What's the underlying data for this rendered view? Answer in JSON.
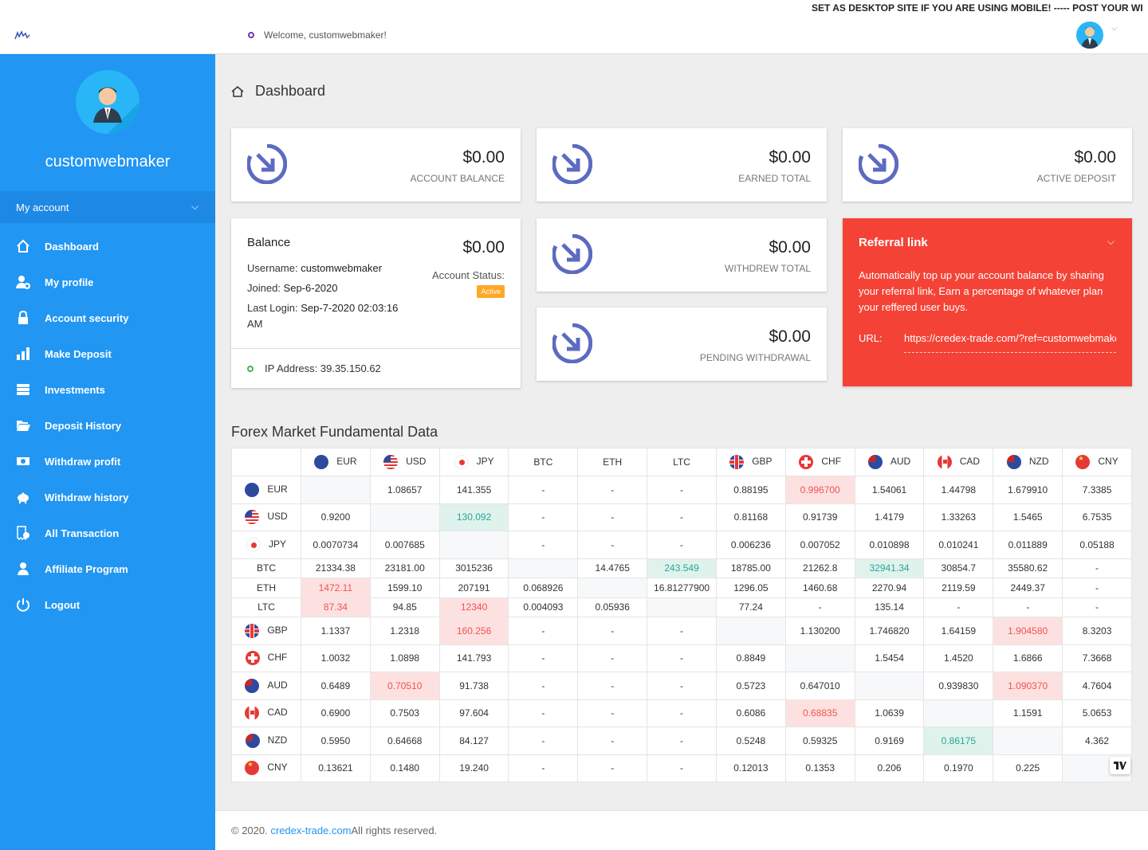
{
  "marquee": "SET AS DESKTOP SITE IF YOU ARE USING MOBILE! ----- POST YOUR WI",
  "topbar": {
    "welcome": "Welcome, customwebmaker!"
  },
  "sidebar": {
    "username": "customwebmaker",
    "account_label": "My account",
    "items": [
      {
        "label": "Dashboard",
        "icon": "home-icon"
      },
      {
        "label": "My profile",
        "icon": "user-add-icon"
      },
      {
        "label": "Account security",
        "icon": "lock-icon"
      },
      {
        "label": "Make Deposit",
        "icon": "bar-chart-icon"
      },
      {
        "label": "Investments",
        "icon": "stack-icon"
      },
      {
        "label": "Deposit History",
        "icon": "folder-open-icon"
      },
      {
        "label": "Withdraw profit",
        "icon": "money-icon"
      },
      {
        "label": "Withdraw history",
        "icon": "piggy-bank-icon"
      },
      {
        "label": "All Transaction",
        "icon": "receipt-icon"
      },
      {
        "label": "Affiliate Program",
        "icon": "users-icon"
      },
      {
        "label": "Logout",
        "icon": "power-icon"
      }
    ]
  },
  "page_title": "Dashboard",
  "stats": {
    "account_balance": {
      "amount": "$0.00",
      "label": "ACCOUNT BALANCE"
    },
    "earned_total": {
      "amount": "$0.00",
      "label": "EARNED TOTAL"
    },
    "active_deposit": {
      "amount": "$0.00",
      "label": "ACTIVE DEPOSIT"
    },
    "withdrew_total": {
      "amount": "$0.00",
      "label": "WITHDREW TOTAL"
    },
    "pending_withdrawal": {
      "amount": "$0.00",
      "label": "PENDING WITHDRAWAL"
    }
  },
  "balance": {
    "title": "Balance",
    "amount": "$0.00",
    "username_label": "Username:",
    "username": "customwebmaker",
    "joined_label": "Joined:",
    "joined": "Sep-6-2020",
    "last_login_label": "Last Login:",
    "last_login": "Sep-7-2020 02:03:16",
    "last_login_suffix": "AM",
    "status_label": "Account Status:",
    "status": "Active",
    "ip_label": "IP Address:",
    "ip": "39.35.150.62"
  },
  "referral": {
    "title": "Referral link",
    "description": "Automatically top up your account balance by sharing your referral link, Earn a percentage of whatever plan your reffered user buys.",
    "url_label": "URL:",
    "url": "https://credex-trade.com/?ref=customwebmaker"
  },
  "forex": {
    "title": "Forex Market Fundamental Data",
    "columns": [
      "EUR",
      "USD",
      "JPY",
      "BTC",
      "ETH",
      "LTC",
      "GBP",
      "CHF",
      "AUD",
      "CAD",
      "NZD",
      "CNY"
    ],
    "flagged": {
      "EUR": "eur",
      "USD": "usd",
      "JPY": "jpy",
      "GBP": "gbp",
      "CHF": "chf",
      "AUD": "aud",
      "CAD": "cad",
      "NZD": "nzd",
      "CNY": "cny"
    },
    "rows": [
      {
        "label": "EUR",
        "cells": [
          "",
          "1.08657",
          "141.355",
          "-",
          "-",
          "-",
          "0.88195",
          "0.996700",
          "1.54061",
          "1.44798",
          "1.679910",
          "7.3385"
        ],
        "styles": [
          "e",
          "",
          "",
          "",
          "",
          "",
          "",
          "lo",
          "",
          "",
          "",
          ""
        ]
      },
      {
        "label": "USD",
        "cells": [
          "0.9200",
          "",
          "130.092",
          "-",
          "-",
          "-",
          "0.81168",
          "0.91739",
          "1.4179",
          "1.33263",
          "1.5465",
          "6.7535"
        ],
        "styles": [
          "",
          "e",
          "hi",
          "",
          "",
          "",
          "",
          "",
          "",
          "",
          "",
          ""
        ]
      },
      {
        "label": "JPY",
        "cells": [
          "0.0070734",
          "0.007685",
          "",
          "-",
          "-",
          "-",
          "0.006236",
          "0.007052",
          "0.010898",
          "0.010241",
          "0.011889",
          "0.05188"
        ],
        "styles": [
          "",
          "",
          "e",
          "",
          "",
          "",
          "",
          "",
          "",
          "",
          "",
          ""
        ]
      },
      {
        "label": "BTC",
        "cells": [
          "21334.38",
          "23181.00",
          "3015236",
          "",
          "14.4765",
          "243.549",
          "18785.00",
          "21262.8",
          "32941.34",
          "30854.7",
          "35580.62",
          "-"
        ],
        "styles": [
          "",
          "",
          "",
          "e",
          "",
          "hi",
          "",
          "",
          "hi",
          "",
          "",
          ""
        ]
      },
      {
        "label": "ETH",
        "cells": [
          "1472.11",
          "1599.10",
          "207191",
          "0.068926",
          "",
          "16.81277900",
          "1296.05",
          "1460.68",
          "2270.94",
          "2119.59",
          "2449.37",
          "-"
        ],
        "styles": [
          "lo",
          "",
          "",
          "",
          "e",
          "",
          "",
          "",
          "",
          "",
          "",
          ""
        ]
      },
      {
        "label": "LTC",
        "cells": [
          "87.34",
          "94.85",
          "12340",
          "0.004093",
          "0.05936",
          "",
          "77.24",
          "-",
          "135.14",
          "-",
          "-",
          "-"
        ],
        "styles": [
          "lo",
          "",
          "lo",
          "",
          "",
          "e",
          "",
          "",
          "",
          "",
          "",
          ""
        ]
      },
      {
        "label": "GBP",
        "cells": [
          "1.1337",
          "1.2318",
          "160.256",
          "-",
          "-",
          "-",
          "",
          "1.130200",
          "1.746820",
          "1.64159",
          "1.904580",
          "8.3203"
        ],
        "styles": [
          "",
          "",
          "lo",
          "",
          "",
          "",
          "e",
          "",
          "",
          "",
          "lo",
          ""
        ]
      },
      {
        "label": "CHF",
        "cells": [
          "1.0032",
          "1.0898",
          "141.793",
          "-",
          "-",
          "-",
          "0.8849",
          "",
          "1.5454",
          "1.4520",
          "1.6866",
          "7.3668"
        ],
        "styles": [
          "",
          "",
          "",
          "",
          "",
          "",
          "",
          "e",
          "",
          "",
          "",
          ""
        ]
      },
      {
        "label": "AUD",
        "cells": [
          "0.6489",
          "0.70510",
          "91.738",
          "-",
          "-",
          "-",
          "0.5723",
          "0.647010",
          "",
          "0.939830",
          "1.090370",
          "4.7604"
        ],
        "styles": [
          "",
          "lo",
          "",
          "",
          "",
          "",
          "",
          "",
          "e",
          "",
          "lo",
          ""
        ]
      },
      {
        "label": "CAD",
        "cells": [
          "0.6900",
          "0.7503",
          "97.604",
          "-",
          "-",
          "-",
          "0.6086",
          "0.68835",
          "1.0639",
          "",
          "1.1591",
          "5.0653"
        ],
        "styles": [
          "",
          "",
          "",
          "",
          "",
          "",
          "",
          "lo",
          "",
          "e",
          "",
          ""
        ]
      },
      {
        "label": "NZD",
        "cells": [
          "0.5950",
          "0.64668",
          "84.127",
          "-",
          "-",
          "-",
          "0.5248",
          "0.59325",
          "0.9169",
          "0.86175",
          "",
          "4.362"
        ],
        "styles": [
          "",
          "",
          "",
          "",
          "",
          "",
          "",
          "",
          "",
          "hi",
          "e",
          ""
        ]
      },
      {
        "label": "CNY",
        "cells": [
          "0.13621",
          "0.1480",
          "19.240",
          "-",
          "-",
          "-",
          "0.12013",
          "0.1353",
          "0.206",
          "0.1970",
          "0.225",
          ""
        ],
        "styles": [
          "",
          "",
          "",
          "",
          "",
          "",
          "",
          "",
          "",
          "",
          "",
          "e"
        ]
      }
    ],
    "tv_badge": "TV"
  },
  "footer": {
    "prefix": "© 2020. ",
    "link": "credex-trade.com",
    "suffix": " All rights reserved."
  }
}
